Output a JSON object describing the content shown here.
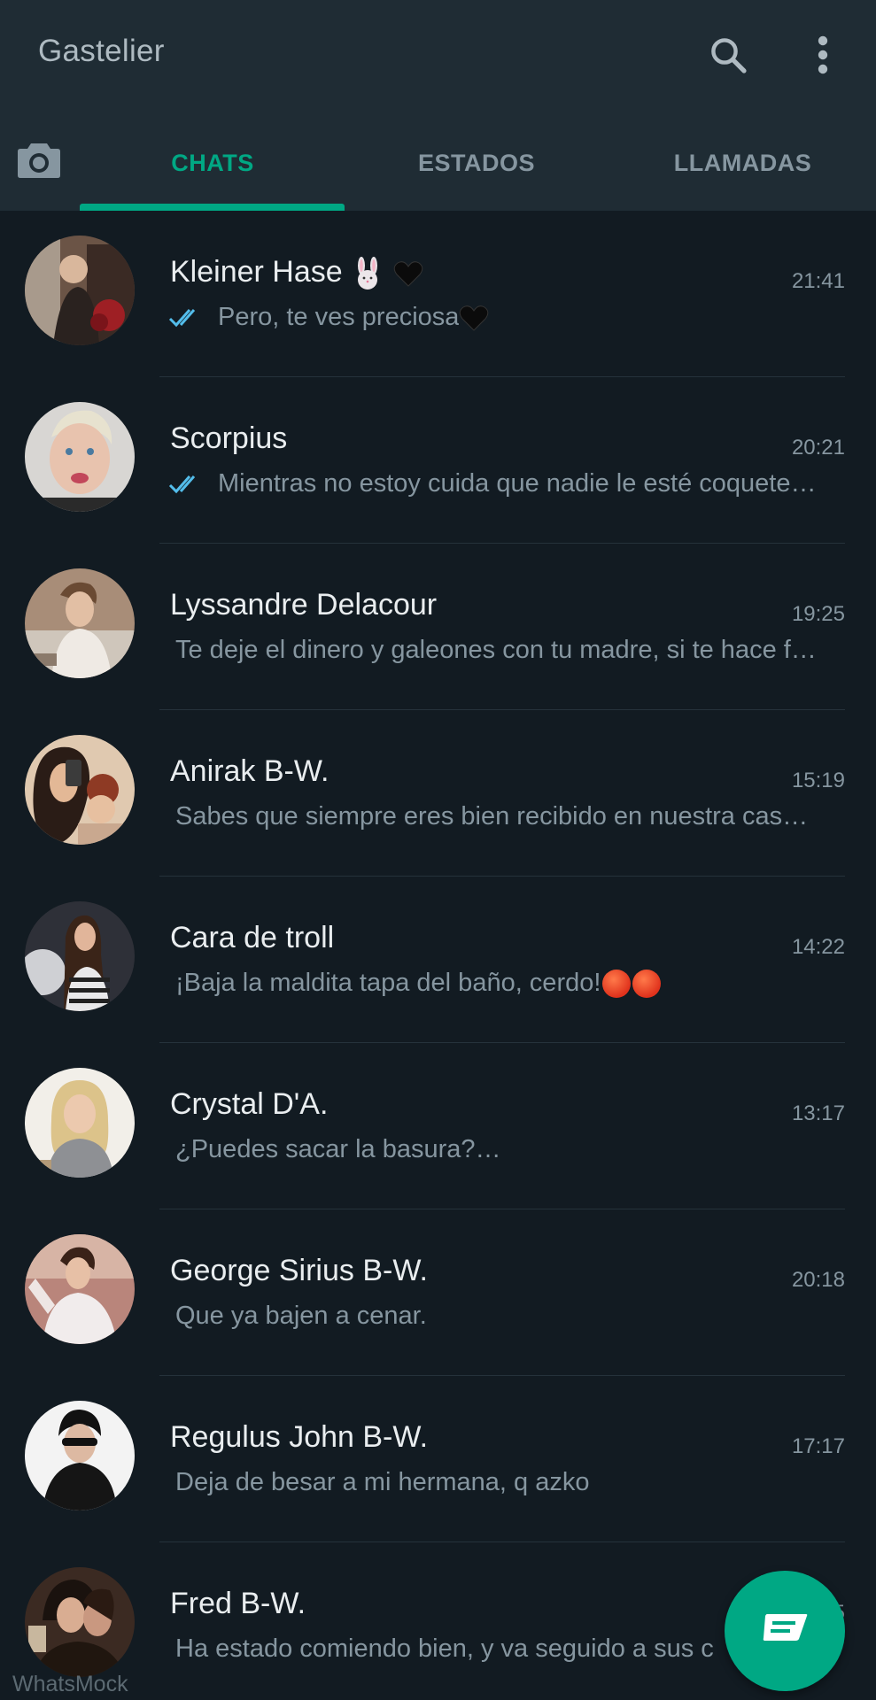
{
  "header": {
    "title": "Gastelier",
    "search_icon": "search-icon",
    "menu_icon": "more-vert-icon"
  },
  "tabs": [
    {
      "label": "CHATS",
      "active": true
    },
    {
      "label": "ESTADOS",
      "active": false
    },
    {
      "label": "LLAMADAS",
      "active": false
    }
  ],
  "colors": {
    "accent": "#00a884",
    "header_bg": "#1f2c34",
    "list_bg": "#121b22",
    "read_check": "#53bdeb"
  },
  "chats": [
    {
      "name": "Kleiner Hase",
      "name_suffix": "bunny-heart",
      "time": "21:41",
      "preview": "Pero, te ves preciosa",
      "preview_suffix": "black-heart",
      "read": true
    },
    {
      "name": "Scorpius",
      "time": "20:21",
      "preview": "Mientras no estoy cuida que nadie le esté coquete…",
      "read": true
    },
    {
      "name": "Lyssandre Delacour",
      "time": "19:25",
      "preview": "Te deje el dinero y galeones con tu madre, si te hace f…",
      "read": false
    },
    {
      "name": "Anirak B-W.",
      "time": "15:19",
      "preview": "Sabes que siempre eres bien recibido en nuestra cas…",
      "read": false
    },
    {
      "name": "Cara de troll",
      "time": "14:22",
      "preview": "¡Baja la maldita tapa del baño, cerdo!",
      "preview_suffix": "angry-faces",
      "read": false
    },
    {
      "name": "Crystal D'A.",
      "time": "13:17",
      "preview": "¿Puedes sacar la basura?…",
      "read": false
    },
    {
      "name": "George Sirius B-W.",
      "time": "20:18",
      "preview": "Que ya bajen a cenar.",
      "read": false
    },
    {
      "name": "Regulus John B-W.",
      "time": "17:17",
      "preview": "Deja de besar a mi hermana, q azko",
      "read": false
    },
    {
      "name": "Fred B-W.",
      "time": "5",
      "preview": "Ha estado comiendo bien, y va seguido a sus c",
      "read": false
    }
  ],
  "fab": {
    "icon": "new-chat-icon"
  },
  "watermark": "WhatsMock"
}
